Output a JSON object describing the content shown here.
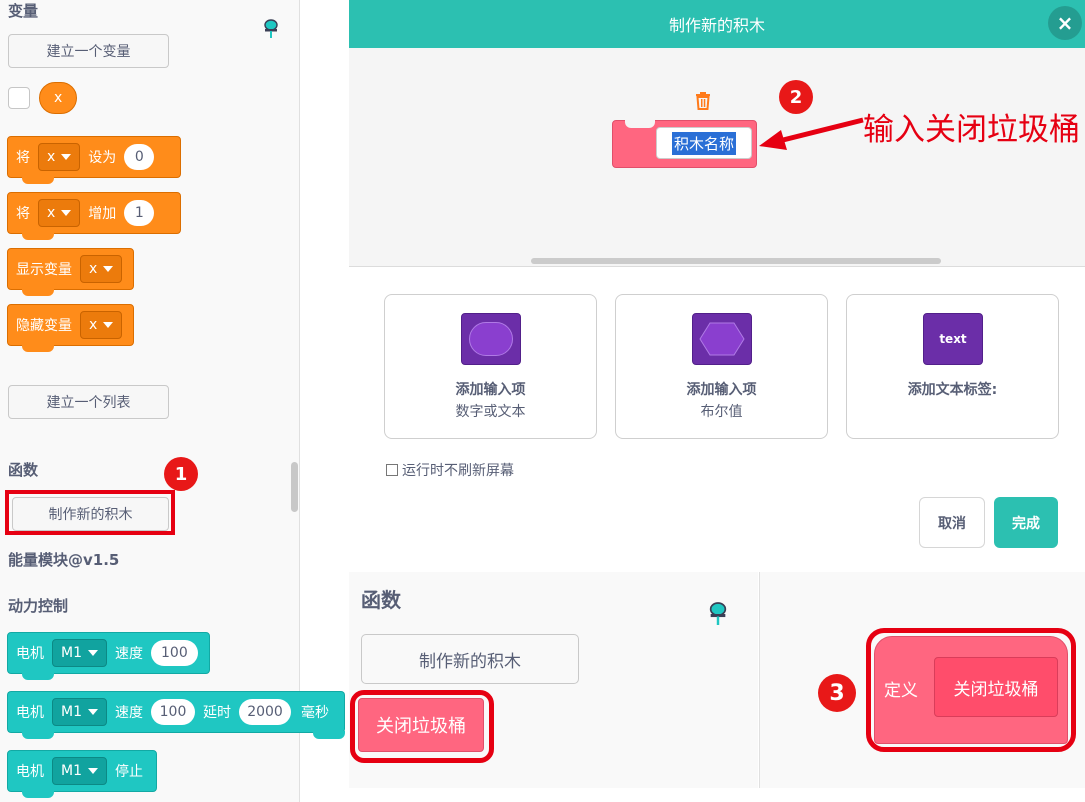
{
  "palette": {
    "variables_title": "变量",
    "make_variable_btn": "建立一个变量",
    "variable_name": "x",
    "set_block": {
      "prefix": "将",
      "var": "x",
      "action": "设为",
      "value": "0"
    },
    "change_block": {
      "prefix": "将",
      "var": "x",
      "action": "增加",
      "value": "1"
    },
    "show_block": {
      "label": "显示变量",
      "var": "x"
    },
    "hide_block": {
      "label": "隐藏变量",
      "var": "x"
    },
    "make_list_btn": "建立一个列表",
    "functions_title": "函数",
    "make_block_btn": "制作新的积木",
    "energy_title": "能量模块@v1.5",
    "power_title": "动力控制",
    "motor_speed": {
      "label": "电机",
      "port": "M1",
      "speed_label": "速度",
      "speed": "100"
    },
    "motor_speed_delay": {
      "label": "电机",
      "port": "M1",
      "speed_label": "速度",
      "speed": "100",
      "delay_label": "延时",
      "delay": "2000",
      "unit": "毫秒"
    },
    "motor_stop": {
      "label": "电机",
      "port": "M1",
      "action": "停止"
    }
  },
  "dialog": {
    "title": "制作新的积木",
    "close_label": "×",
    "block_name_placeholder": "积木名称",
    "options": [
      {
        "title": "添加输入项",
        "subtitle": "数字或文本"
      },
      {
        "title": "添加输入项",
        "subtitle": "布尔值"
      },
      {
        "title": "添加文本标签:",
        "icon_text": "text"
      }
    ],
    "run_without_refresh": "运行时不刷新屏幕",
    "cancel": "取消",
    "done": "完成"
  },
  "inset": {
    "functions_title": "函数",
    "make_block_btn": "制作新的积木",
    "custom_block": "关闭垃圾桶",
    "define_label": "定义",
    "define_block_name": "关闭垃圾桶"
  },
  "annotations": {
    "step1": "1",
    "step2": "2",
    "step3": "3",
    "instruction": "输入关闭垃圾桶"
  },
  "colors": {
    "header": "#2cc0b1",
    "custom_block": "#ff6680",
    "variables": "#ff8c1a",
    "motion": "#1fc7c2",
    "annotation": "#e60012"
  }
}
